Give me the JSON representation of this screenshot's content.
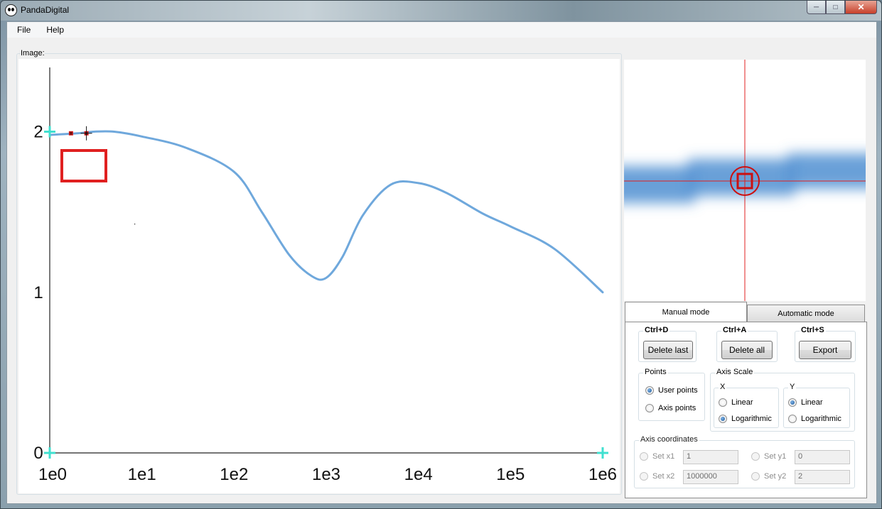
{
  "window": {
    "title": "PandaDigital"
  },
  "menu": {
    "file": "File",
    "help": "Help"
  },
  "image_group": {
    "label": "Image:"
  },
  "chart_data": {
    "type": "line",
    "x_tick_labels": [
      "1e0",
      "1e1",
      "1e2",
      "1e3",
      "1e4",
      "1e5",
      "1e6"
    ],
    "y_tick_labels": [
      "0",
      "1",
      "2"
    ],
    "xlim": [
      1,
      1000000
    ],
    "ylim": [
      0,
      2.4
    ],
    "x_scale": "log",
    "grid": false,
    "series": [
      {
        "color": "#6fa8dc",
        "x": [
          1,
          2,
          3,
          5,
          10,
          30,
          100,
          200,
          400,
          700,
          1000,
          1500,
          2500,
          5000,
          10000,
          20000,
          50000,
          100000,
          300000,
          1000000
        ],
        "y": [
          1.98,
          1.99,
          2.0,
          2.0,
          1.97,
          1.9,
          1.75,
          1.5,
          1.23,
          1.1,
          1.09,
          1.22,
          1.48,
          1.67,
          1.68,
          1.62,
          1.49,
          1.41,
          1.27,
          1.0
        ]
      }
    ],
    "axis_markers": [
      {
        "x": 1,
        "y": 2
      },
      {
        "x": 1,
        "y": 0
      },
      {
        "x": 1000000,
        "y": 0
      }
    ],
    "user_points": [
      {
        "x": 1.7,
        "y": 1.99
      },
      {
        "x": 2.5,
        "y": 1.99
      }
    ]
  },
  "colors": {
    "curve": "#6fa8dc",
    "axis_marker": "#40e0d0",
    "selection": "#e02020"
  },
  "tabs": {
    "manual": "Manual mode",
    "automatic": "Automatic mode"
  },
  "manual": {
    "delete_last": {
      "shortcut": "Ctrl+D",
      "label": "Delete last"
    },
    "delete_all": {
      "shortcut": "Ctrl+A",
      "label": "Delete all"
    },
    "export": {
      "shortcut": "Ctrl+S",
      "label": "Export"
    },
    "points": {
      "title": "Points",
      "user_points": "User points",
      "axis_points": "Axis points",
      "selected": "User points"
    },
    "axis_scale": {
      "title": "Axis Scale",
      "x": {
        "title": "X",
        "linear": "Linear",
        "log": "Logarithmic",
        "selected": "Logarithmic"
      },
      "y": {
        "title": "Y",
        "linear": "Linear",
        "log": "Logarithmic",
        "selected": "Linear"
      }
    },
    "axis_coordinates": {
      "title": "Axis coordinates",
      "set_x1": {
        "label": "Set x1",
        "value": "1"
      },
      "set_x2": {
        "label": "Set x2",
        "value": "1000000"
      },
      "set_y1": {
        "label": "Set y1",
        "value": "0"
      },
      "set_y2": {
        "label": "Set y2",
        "value": "2"
      }
    }
  }
}
